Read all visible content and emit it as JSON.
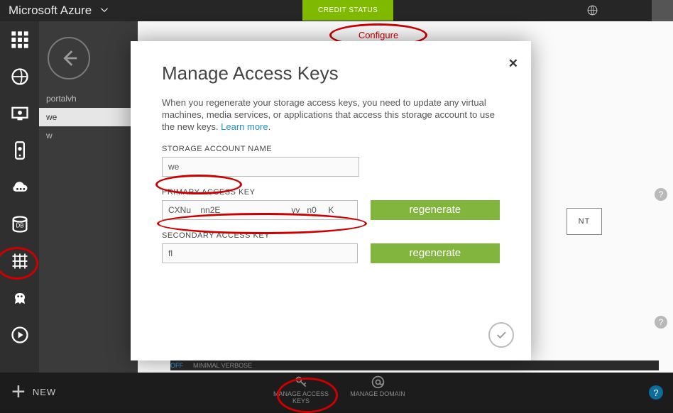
{
  "header": {
    "brand": "Microsoft Azure",
    "credit_status": "CREDIT STATUS"
  },
  "col2": {
    "items": [
      "portalvh",
      "we",
      "w"
    ]
  },
  "main": {
    "configure": "Configure",
    "btn_frag": "NT",
    "dark_off": "OFF",
    "dark_rest": "MINIMAL   VERBOSE"
  },
  "modal": {
    "title": "Manage Access Keys",
    "desc": "When you regenerate your storage access keys, you need to update any virtual machines, media services, or applications that access this storage account to use the new keys.",
    "learn_more": "Learn more",
    "label_account": "STORAGE ACCOUNT NAME",
    "val_account": "we",
    "label_primary": "PRIMARY ACCESS KEY",
    "val_primary": "CXNu    nn2E                              yv   n0     K",
    "label_secondary": "SECONDARY ACCESS KEY",
    "val_secondary": "fl",
    "regenerate": "regenerate"
  },
  "bottom": {
    "new": "NEW",
    "manage_keys": "MANAGE ACCESS KEYS",
    "manage_domain": "MANAGE DOMAIN"
  }
}
